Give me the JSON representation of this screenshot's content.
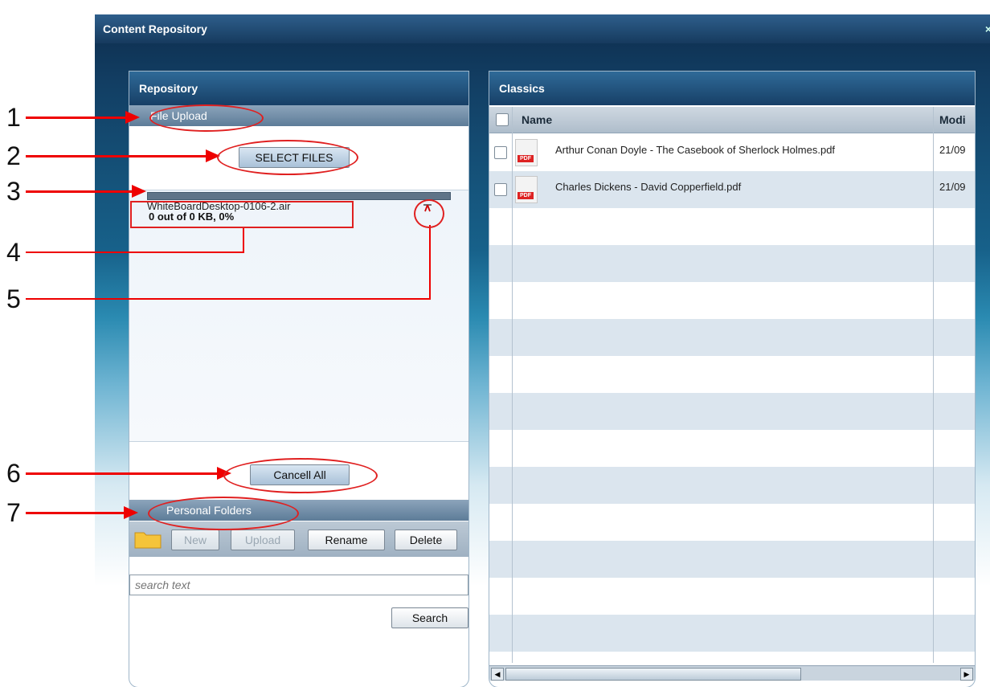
{
  "window": {
    "title": "Content Repository",
    "close_glyph": "×"
  },
  "repository": {
    "title": "Repository",
    "file_upload_label": "File Upload",
    "select_files_label": "SELECT FILES",
    "upload_item": {
      "file_name": "WhiteBoardDesktop-0106-2.air",
      "progress_text": "0 out of 0 KB, 0%",
      "progress": 0
    },
    "cancel_all_label": "Cancell All",
    "personal_folders_label": "Personal Folders",
    "toolbar": {
      "new_label": "New",
      "upload_label": "Upload",
      "rename_label": "Rename",
      "delete_label": "Delete"
    },
    "search": {
      "placeholder": "search text",
      "button_label": "Search"
    }
  },
  "classics": {
    "title": "Classics",
    "columns": {
      "name": "Name",
      "modified": "Modi"
    },
    "files": [
      {
        "name": "Arthur Conan Doyle - The Casebook of Sherlock Holmes.pdf",
        "modified": "21/09"
      },
      {
        "name": "Charles Dickens - David Copperfield.pdf",
        "modified": "21/09"
      }
    ]
  },
  "annotations": [
    "1",
    "2",
    "3",
    "4",
    "5",
    "6",
    "7"
  ],
  "colors": {
    "annotation": "#e00000",
    "header_dark": "#173f66"
  }
}
